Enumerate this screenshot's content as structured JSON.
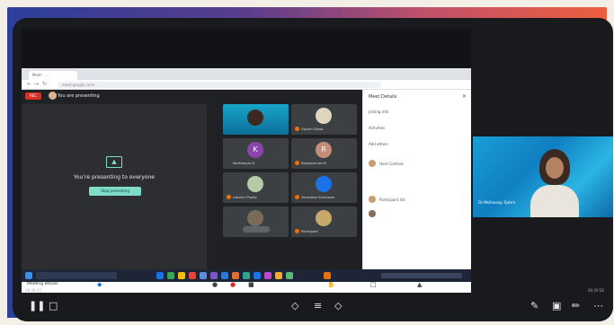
{
  "browser": {
    "tab_title": "Meet - ...",
    "url": "meet.google.com/..."
  },
  "meet": {
    "rec_badge": "REC",
    "presenting_label": "You are presenting",
    "stage_text": "You're presenting to everyone",
    "stop_button": "Stop presenting",
    "tiles": [
      {
        "name": "Gayatri Dhoot",
        "color": "#e0d6c0"
      },
      {
        "name": "Karthikeyan K",
        "color": "#8e44ad"
      },
      {
        "name": "Raghavendra M",
        "color": "#c58c7a"
      },
      {
        "name": "Lakshmi Pradip",
        "color": "#b8c9a8"
      },
      {
        "name": "Venkatesh Srinivasan",
        "color": "#1a73e8"
      },
      {
        "name": "",
        "color": "#7a6a5a"
      },
      {
        "name": "Participant",
        "color": "#c9a86b"
      }
    ],
    "tile_letters": [
      "K",
      "R"
    ],
    "meeting_details": "Meeting details"
  },
  "panel": {
    "title": "Meet Details",
    "rows": [
      {
        "label": "Joining info"
      },
      {
        "label": "Activities"
      },
      {
        "label": "Add others"
      },
      {
        "label": "Host Controls"
      },
      {
        "label": "Participant list"
      }
    ]
  },
  "camera": {
    "name": "Dr.Mohanap Sahni"
  },
  "clock": {
    "left": "00:28:17",
    "right": "00:29:56"
  },
  "colors": {
    "accent": "#7fdcc7",
    "rec": "#d93025",
    "frame_start": "#2c3f9a",
    "frame_end": "#ec5f3e"
  }
}
